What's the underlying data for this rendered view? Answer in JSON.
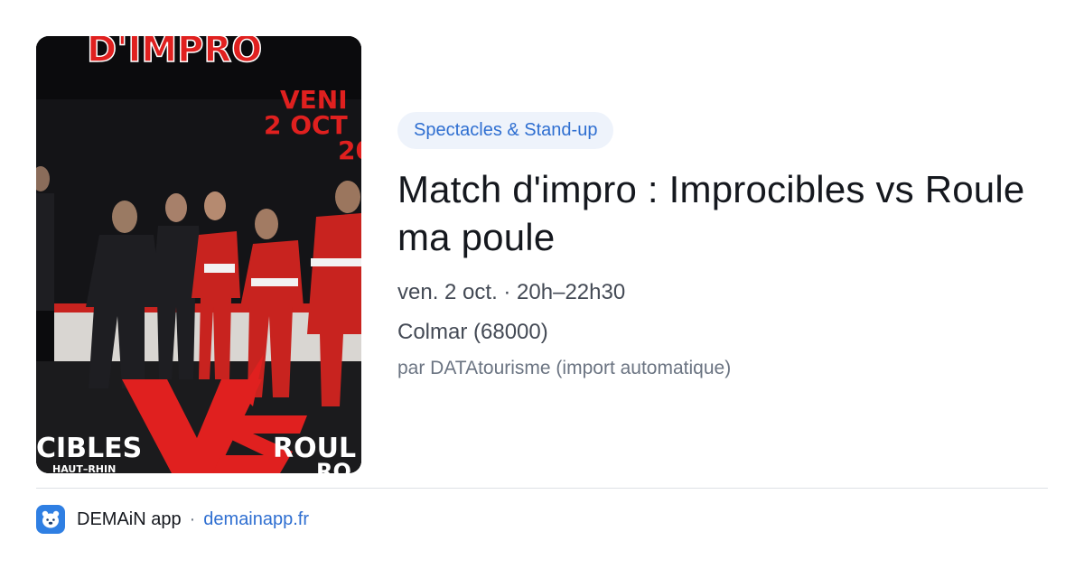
{
  "poster": {
    "top_text": "D'IMPRO",
    "date_line1": "VENI",
    "date_line2": "2 OCT",
    "date_line3": "20",
    "team_left": "CIBLES",
    "team_left_sub": "HAUT–RHIN",
    "versus": "VS",
    "team_right": "ROUL",
    "team_right_sub": "RO",
    "colors": {
      "background": "#0b0b0d",
      "accent_red": "#e0201f",
      "white": "#ffffff"
    }
  },
  "event": {
    "category": "Spectacles & Stand-up",
    "title": "Match d'impro : Improcibles vs Roule ma poule",
    "datetime": "ven. 2 oct. · 20h–22h30",
    "location": "Colmar (68000)",
    "source": "par DATAtourisme (import automatique)"
  },
  "footer": {
    "app_icon": "bear-icon",
    "app_name": "DEMAiN app",
    "separator": "·",
    "link": "demainapp.fr"
  },
  "colors": {
    "accent": "#2f6fd1",
    "category_bg": "#eef3fb",
    "title": "#15181e",
    "meta": "#444a55",
    "muted": "#6b7482",
    "app_icon_bg": "#2f7fe3"
  }
}
